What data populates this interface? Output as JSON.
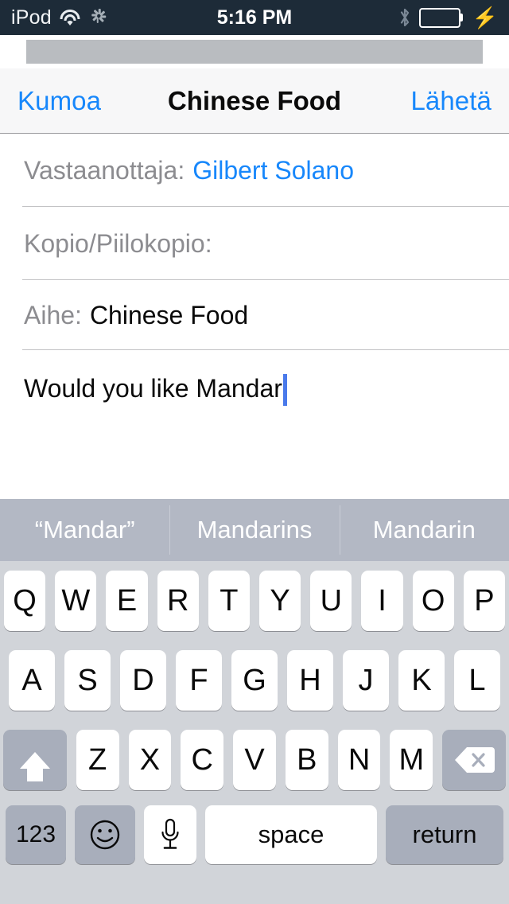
{
  "status_bar": {
    "carrier": "iPod",
    "time": "5:16 PM",
    "wifi_icon": "wifi-icon",
    "activity_icon": "activity-spinner-icon",
    "bluetooth_icon": "bluetooth-icon",
    "battery_icon": "battery-full-icon",
    "charging_icon": "charging-bolt-icon",
    "background_color": "#1d2b38",
    "battery_color": "#4cd964"
  },
  "nav_bar": {
    "cancel_label": "Kumoa",
    "title": "Chinese Food",
    "send_label": "Lähetä",
    "accent_color": "#1787fb"
  },
  "compose": {
    "to": {
      "label": "Vastaanottaja:",
      "value": "Gilbert Solano"
    },
    "cc_bcc": {
      "label": "Kopio/Piilokopio:",
      "value": ""
    },
    "subject": {
      "label": "Aihe:",
      "value": "Chinese Food"
    },
    "body": {
      "value": "Would you like Mandar",
      "caret_color": "#4a7aeb"
    }
  },
  "keyboard": {
    "suggestions": [
      "“Mandar”",
      "Mandarins",
      "Mandarin"
    ],
    "row1": [
      "Q",
      "W",
      "E",
      "R",
      "T",
      "Y",
      "U",
      "I",
      "O",
      "P"
    ],
    "row2": [
      "A",
      "S",
      "D",
      "F",
      "G",
      "H",
      "J",
      "K",
      "L"
    ],
    "row3": [
      "Z",
      "X",
      "C",
      "V",
      "B",
      "N",
      "M"
    ],
    "shift_icon": "shift-arrow-icon",
    "delete_icon": "backspace-delete-icon",
    "numbers_label": "123",
    "emoji_icon": "emoji-smiley-icon",
    "dictation_icon": "microphone-icon",
    "space_label": "space",
    "return_label": "return",
    "background_color": "#d1d4d9",
    "suggestion_bar_color": "#b3b8c4",
    "function_key_color": "#a8aebb"
  }
}
